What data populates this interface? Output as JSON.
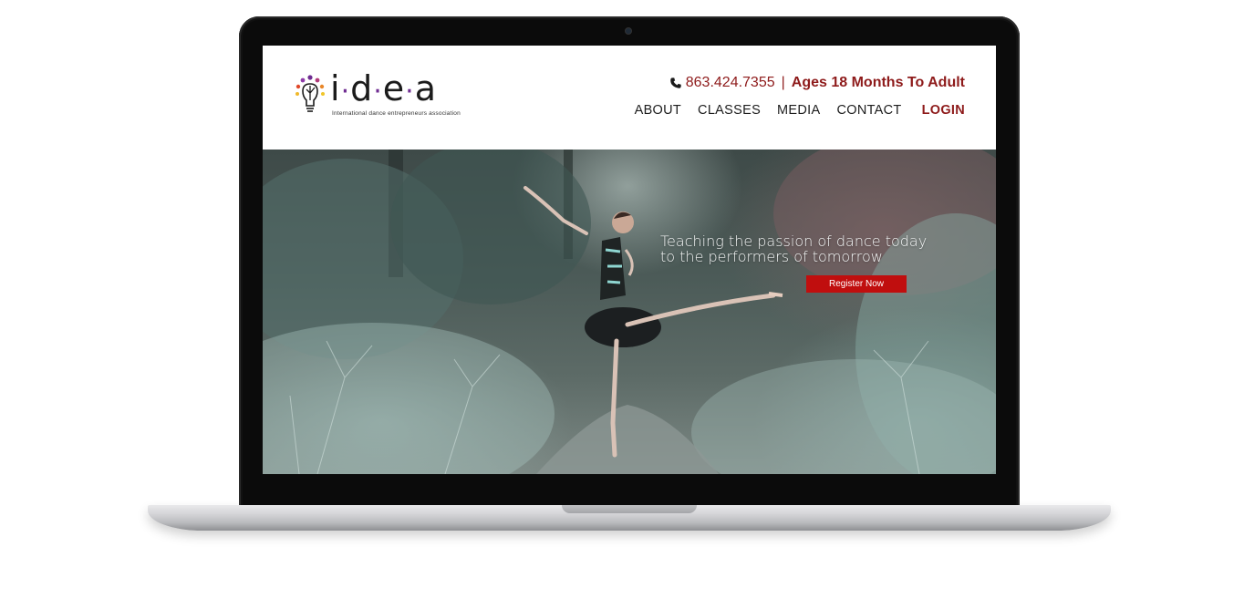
{
  "logo": {
    "wordmark_letters": [
      "i",
      "d",
      "e",
      "a"
    ],
    "tagline": "International dance entrepreneurs association",
    "icon": "lightbulb-dancer-icon",
    "accent_color": "#6f2c91"
  },
  "header": {
    "phone": "863.424.7355",
    "separator": "|",
    "ages": "Ages 18 Months To Adult",
    "phone_icon": "phone-icon",
    "accent_color": "#8e1b1b"
  },
  "nav": {
    "items": [
      {
        "label": "ABOUT"
      },
      {
        "label": "CLASSES"
      },
      {
        "label": "MEDIA"
      },
      {
        "label": "CONTACT"
      },
      {
        "label": "LOGIN"
      }
    ]
  },
  "hero": {
    "line1": "Teaching the passion of dance today",
    "line2": "to the performers of tomorrow",
    "cta_label": "Register Now",
    "cta_color": "#c00e0e"
  }
}
